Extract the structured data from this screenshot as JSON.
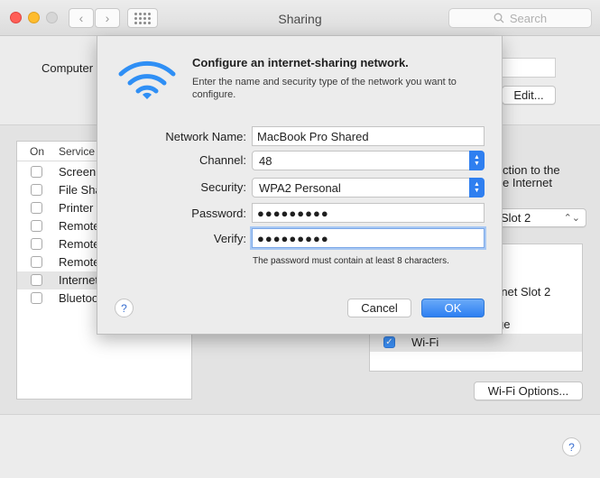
{
  "window": {
    "title": "Sharing"
  },
  "search": {
    "placeholder": "Search"
  },
  "background": {
    "computer_name_label": "Computer",
    "edit_button": "Edit...",
    "services_header": {
      "on": "On",
      "service": "Service"
    },
    "services": [
      {
        "label": "Screen",
        "checked": false
      },
      {
        "label": "File Sha",
        "checked": false
      },
      {
        "label": "Printer",
        "checked": false
      },
      {
        "label": "Remote",
        "checked": false
      },
      {
        "label": "Remote",
        "checked": false
      },
      {
        "label": "Remote",
        "checked": false
      },
      {
        "label": "Internet",
        "checked": false,
        "selected": true
      },
      {
        "label": "Bluetoo",
        "checked": false
      }
    ],
    "share_desc_line1": "ction to the",
    "share_desc_line2": "e Internet",
    "share_from_value": "Slot 2",
    "ports": [
      {
        "label": "rnet Slot 2"
      },
      {
        "label": "ge"
      },
      {
        "label": "Wi-Fi",
        "checked": true
      }
    ],
    "wifi_options_button": "Wi-Fi Options...",
    "help": "?"
  },
  "sheet": {
    "title": "Configure an internet-sharing network.",
    "description": "Enter the name and security type of the network you want to configure.",
    "fields": {
      "network_name": {
        "label": "Network Name:",
        "value": "MacBook Pro Shared"
      },
      "channel": {
        "label": "Channel:",
        "value": "48"
      },
      "security": {
        "label": "Security:",
        "value": "WPA2 Personal"
      },
      "password": {
        "label": "Password:",
        "value": "●●●●●●●●●"
      },
      "verify": {
        "label": "Verify:",
        "value": "●●●●●●●●●"
      }
    },
    "hint": "The password must contain at least 8 characters.",
    "help": "?",
    "cancel_button": "Cancel",
    "ok_button": "OK"
  },
  "colors": {
    "accent": "#2f7ff0",
    "wifi_icon": "#2f8ff5"
  }
}
